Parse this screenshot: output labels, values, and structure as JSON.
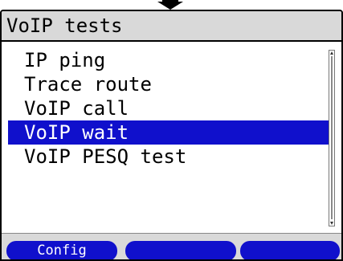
{
  "window": {
    "title": "VoIP tests"
  },
  "menu": {
    "items": [
      {
        "label": "IP ping",
        "selected": false
      },
      {
        "label": "Trace route",
        "selected": false
      },
      {
        "label": "VoIP call",
        "selected": false
      },
      {
        "label": "VoIP wait",
        "selected": true
      },
      {
        "label": "VoIP PESQ test",
        "selected": false
      }
    ]
  },
  "softkeys": {
    "key1": "Config",
    "key2": "",
    "key3": ""
  },
  "colors": {
    "accent": "#1010cc",
    "titlebar": "#d9d9d9",
    "text": "#000000"
  },
  "icons": {
    "top_indicator": "down-arrow-icon"
  }
}
